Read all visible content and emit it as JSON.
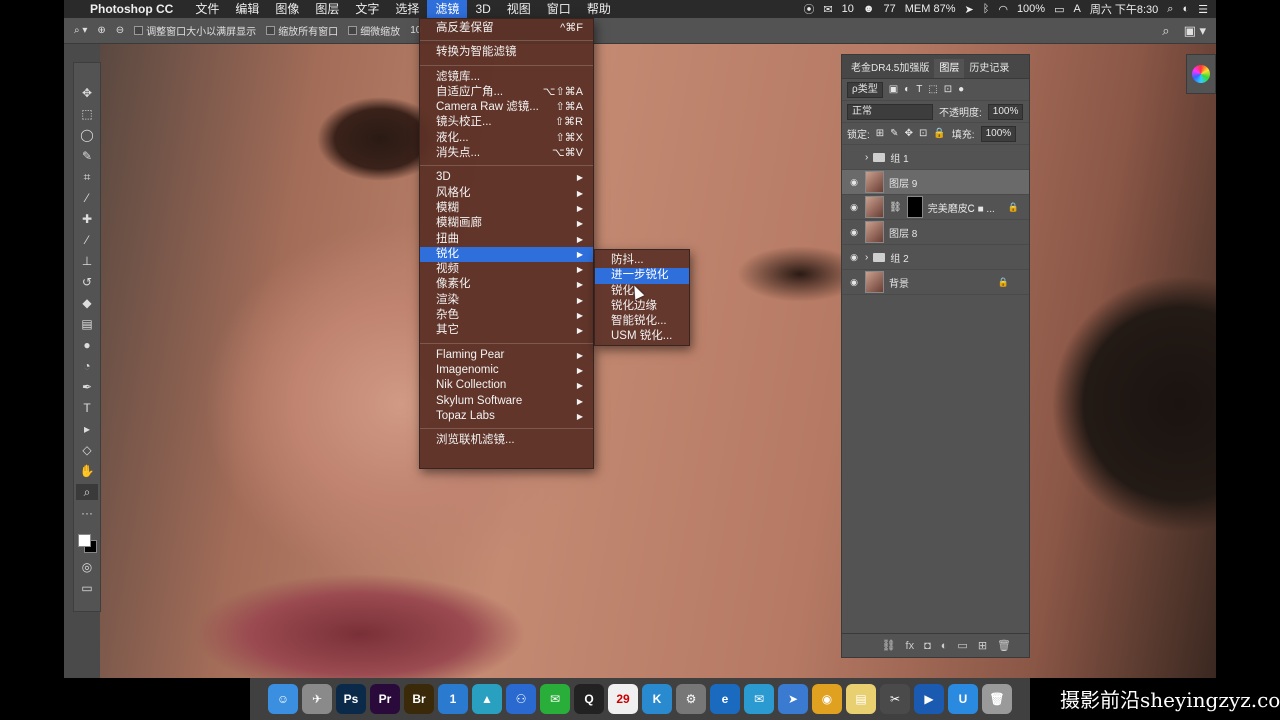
{
  "menubar": {
    "app_name": "Photoshop CC",
    "items": [
      "文件",
      "编辑",
      "图像",
      "图层",
      "文字",
      "选择",
      "滤镜",
      "3D",
      "视图",
      "窗口",
      "帮助"
    ],
    "active_item": "滤镜",
    "status": {
      "wechat_count": "10",
      "qq_count": "77",
      "battery": "100%",
      "time": "周六 下午8:30",
      "mem": "MEM 87%"
    }
  },
  "options_bar": {
    "resize_label": "调整窗口大小以满屏显示",
    "zoom_all_label": "缩放所有窗口",
    "scrubby_label": "细微缩放",
    "zoom_value": "10"
  },
  "filter_menu": {
    "group1": [
      {
        "label": "高反差保留",
        "shortcut": "^⌘F"
      }
    ],
    "group2": [
      {
        "label": "转换为智能滤镜",
        "shortcut": ""
      }
    ],
    "group3": [
      {
        "label": "滤镜库...",
        "shortcut": ""
      },
      {
        "label": "自适应广角...",
        "shortcut": "⌥⇧⌘A"
      },
      {
        "label": "Camera Raw 滤镜...",
        "shortcut": "⇧⌘A"
      },
      {
        "label": "镜头校正...",
        "shortcut": "⇧⌘R"
      },
      {
        "label": "液化...",
        "shortcut": "⇧⌘X"
      },
      {
        "label": "消失点...",
        "shortcut": "⌥⌘V"
      }
    ],
    "group4": [
      "3D",
      "风格化",
      "模糊",
      "模糊画廊",
      "扭曲",
      "锐化",
      "视频",
      "像素化",
      "渲染",
      "杂色",
      "其它"
    ],
    "group4_active": "锐化",
    "group5": [
      "Flaming Pear",
      "Imagenomic",
      "Nik Collection",
      "Skylum Software",
      "Topaz Labs"
    ],
    "group6": [
      "浏览联机滤镜..."
    ]
  },
  "sharpen_submenu": {
    "items": [
      "防抖...",
      "进一步锐化",
      "锐化",
      "锐化边缘",
      "智能锐化...",
      "USM 锐化..."
    ],
    "active": "进一步锐化"
  },
  "layers_panel": {
    "tabs": [
      "老金DR4.5加强版",
      "图层",
      "历史记录"
    ],
    "active_tab": "图层",
    "kind_filter": "ρ类型",
    "blend_mode": "正常",
    "opacity_label": "不透明度:",
    "opacity_value": "100%",
    "lock_label": "锁定:",
    "fill_label": "填充:",
    "fill_value": "100%",
    "layers": [
      {
        "name": "组 1",
        "type": "group",
        "visible": false
      },
      {
        "name": "图层 9",
        "type": "layer",
        "visible": true,
        "active": true
      },
      {
        "name": "完美磨皮Ꮯ ■ ...",
        "type": "layer-mask",
        "visible": true
      },
      {
        "name": "图层 8",
        "type": "layer",
        "visible": true
      },
      {
        "name": "组 2",
        "type": "group",
        "visible": true
      },
      {
        "name": "背景",
        "type": "layer",
        "visible": true,
        "locked": true
      }
    ]
  },
  "dock": {
    "items": [
      {
        "name": "finder",
        "label": "☺",
        "color": "#3b8fe0"
      },
      {
        "name": "launchpad",
        "label": "✈",
        "color": "#8a8a8a"
      },
      {
        "name": "photoshop",
        "label": "Ps",
        "color": "#0b2a4a"
      },
      {
        "name": "premiere",
        "label": "Pr",
        "color": "#2a0a3a"
      },
      {
        "name": "bridge",
        "label": "Br",
        "color": "#3a2a0a"
      },
      {
        "name": "1password",
        "label": "1",
        "color": "#2a7ad0"
      },
      {
        "name": "affinity",
        "label": "▲",
        "color": "#2aa0c0"
      },
      {
        "name": "baidu",
        "label": "⚇",
        "color": "#2a6ad0"
      },
      {
        "name": "wechat",
        "label": "✉",
        "color": "#2aae3a"
      },
      {
        "name": "qq",
        "label": "Q",
        "color": "#222"
      },
      {
        "name": "calendar",
        "label": "29",
        "color": "#f0f0f0"
      },
      {
        "name": "kuaibo",
        "label": "K",
        "color": "#2a8ad0"
      },
      {
        "name": "prefs",
        "label": "⚙",
        "color": "#777"
      },
      {
        "name": "edge",
        "label": "e",
        "color": "#1a6ac0"
      },
      {
        "name": "mail",
        "label": "✉",
        "color": "#2a9ad0"
      },
      {
        "name": "paw",
        "label": "➤",
        "color": "#3a7ad0"
      },
      {
        "name": "chrome",
        "label": "◉",
        "color": "#e0a020"
      },
      {
        "name": "notes",
        "label": "▤",
        "color": "#e8d070"
      },
      {
        "name": "xcode",
        "label": "✂",
        "color": "#4a4a4a"
      },
      {
        "name": "player",
        "label": "▶",
        "color": "#1a5ab0"
      },
      {
        "name": "appstore",
        "label": "U",
        "color": "#2a8ae0"
      },
      {
        "name": "trash",
        "label": "🗑",
        "color": "#9a9a9a"
      }
    ]
  },
  "watermark": "摄影前沿sheyingzyz.com"
}
